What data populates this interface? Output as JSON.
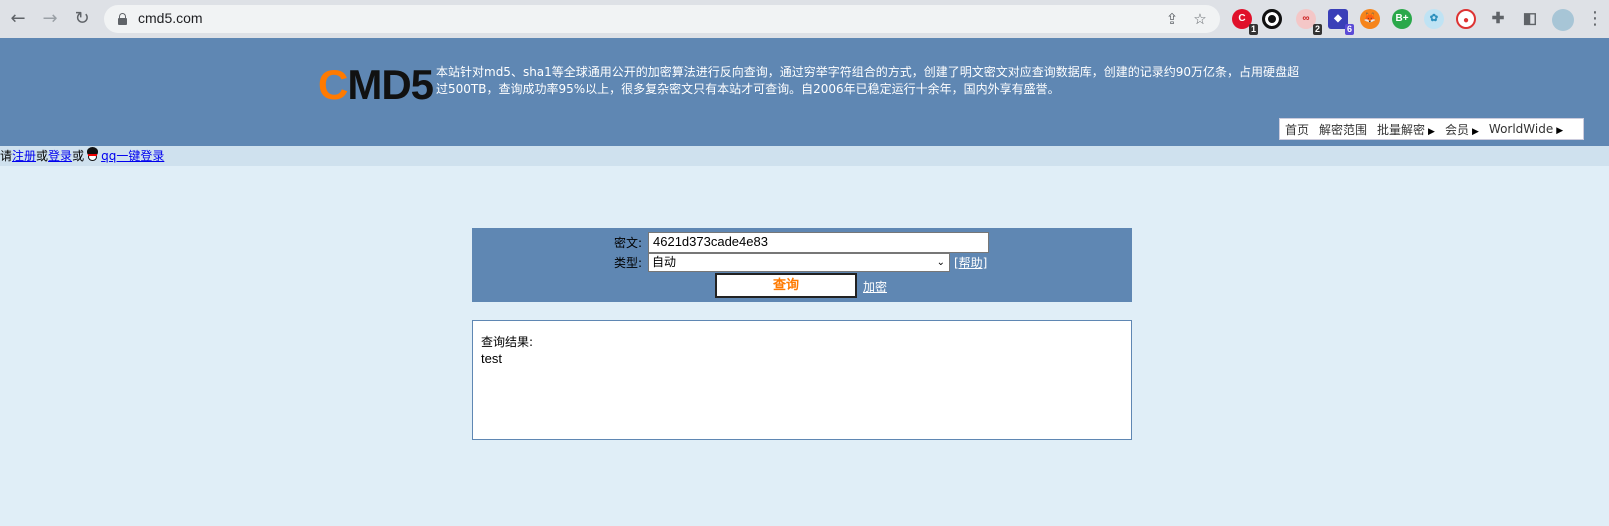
{
  "browser": {
    "url": "cmd5.com",
    "extension_badges": [
      "1",
      "2",
      "6"
    ]
  },
  "site": {
    "logo_c": "C",
    "logo_rest": "MD5",
    "intro": "本站针对md5、sha1等全球通用公开的加密算法进行反向查询，通过穷举字符组合的方式，创建了明文密文对应查询数据库，创建的记录约90万亿条，占用硬盘超过500TB，查询成功率95%以上，很多复杂密文只有本站才可查询。自2006年已稳定运行十余年，国内外享有盛誉。",
    "nav": [
      "首页",
      "解密范围",
      "批量解密",
      "会员",
      "WorldWide"
    ]
  },
  "login": {
    "prefix": "请",
    "register": "注册",
    "or1": "或",
    "login": "登录",
    "or2": "或",
    "qq_login": "qq一键登录"
  },
  "query": {
    "cipher_label": "密文:",
    "cipher_value": "4621d373cade4e83",
    "type_label": "类型:",
    "type_value": "自动",
    "help": "[帮助]",
    "submit": "查询",
    "encrypt": "加密"
  },
  "result": {
    "label": "查询结果:",
    "value": "test"
  },
  "colors": {
    "header_bg": "#5f87b3",
    "page_bg": "#e0eef7",
    "accent": "#ff7a00"
  }
}
